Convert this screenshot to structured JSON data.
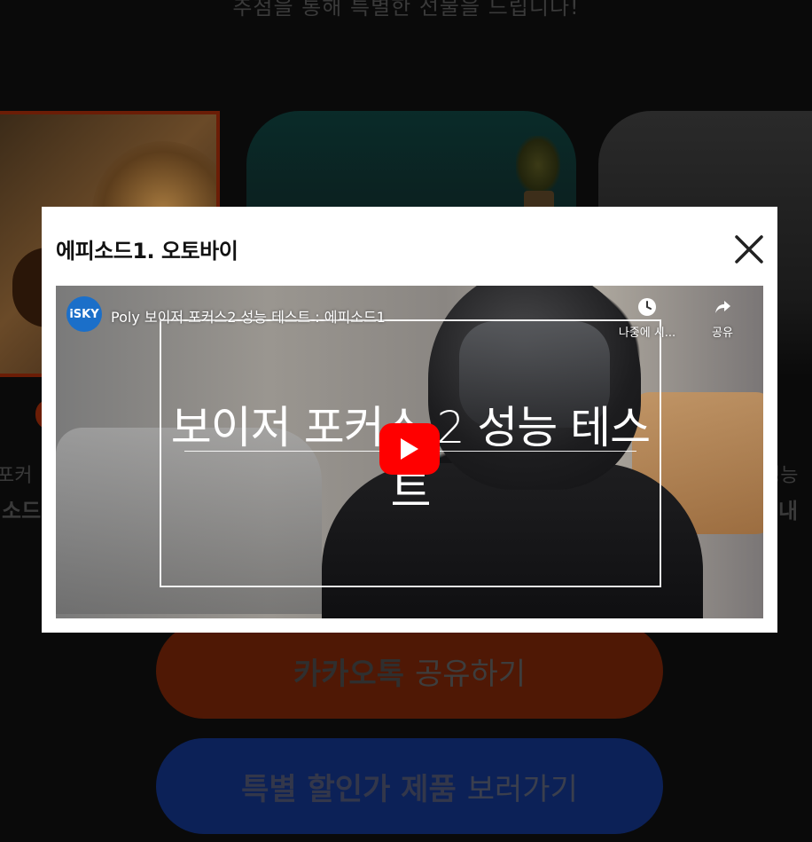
{
  "background": {
    "subtitle": "추첨을 통해 특별한 선물을 드립니다!",
    "side_left_line1": "포커",
    "side_left_line2": "소드",
    "side_right_line1": "성능",
    "side_right_line2": "내",
    "kakao_button": {
      "bold": "카카오톡",
      "rest": "공유하기"
    },
    "sale_button": {
      "bold": "특별 할인가 제품",
      "rest": "보러가기"
    }
  },
  "modal": {
    "title": "에피소드1. 오토바이",
    "close_icon": "close-icon",
    "video": {
      "channel_logo_text": "iSKY",
      "title": "Poly 보이저 포커스2 성능 테스트 : 에피소드1",
      "headline": "보이저 포커스 2 성능 테스트",
      "watch_later_label": "나중에 시...",
      "share_label": "공유",
      "play_icon": "youtube-play-icon",
      "colors": {
        "play": "#ff0000",
        "channel": "#1b6fc9"
      }
    }
  }
}
